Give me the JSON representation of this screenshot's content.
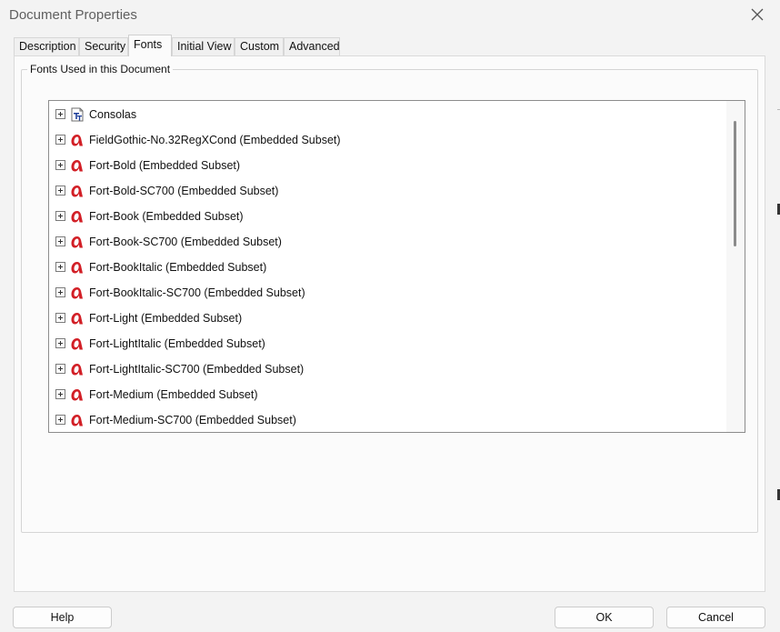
{
  "window": {
    "title": "Document Properties"
  },
  "tabs": [
    {
      "label": "Description",
      "active": false
    },
    {
      "label": "Security",
      "active": false
    },
    {
      "label": "Fonts",
      "active": true
    },
    {
      "label": "Initial View",
      "active": false
    },
    {
      "label": "Custom",
      "active": false
    },
    {
      "label": "Advanced",
      "active": false
    }
  ],
  "fonts_section": {
    "label": "Fonts Used in this Document",
    "items": [
      {
        "name": "Consolas",
        "icon": "truetype-font-icon"
      },
      {
        "name": "FieldGothic-No.32RegXCond (Embedded Subset)",
        "icon": "opentype-font-icon"
      },
      {
        "name": "Fort-Bold (Embedded Subset)",
        "icon": "opentype-font-icon"
      },
      {
        "name": "Fort-Bold-SC700 (Embedded Subset)",
        "icon": "opentype-font-icon"
      },
      {
        "name": "Fort-Book (Embedded Subset)",
        "icon": "opentype-font-icon"
      },
      {
        "name": "Fort-Book-SC700 (Embedded Subset)",
        "icon": "opentype-font-icon"
      },
      {
        "name": "Fort-BookItalic (Embedded Subset)",
        "icon": "opentype-font-icon"
      },
      {
        "name": "Fort-BookItalic-SC700 (Embedded Subset)",
        "icon": "opentype-font-icon"
      },
      {
        "name": "Fort-Light (Embedded Subset)",
        "icon": "opentype-font-icon"
      },
      {
        "name": "Fort-LightItalic (Embedded Subset)",
        "icon": "opentype-font-icon"
      },
      {
        "name": "Fort-LightItalic-SC700 (Embedded Subset)",
        "icon": "opentype-font-icon"
      },
      {
        "name": "Fort-Medium (Embedded Subset)",
        "icon": "opentype-font-icon"
      },
      {
        "name": "Fort-Medium-SC700 (Embedded Subset)",
        "icon": "opentype-font-icon"
      }
    ]
  },
  "buttons": {
    "help": "Help",
    "ok": "OK",
    "cancel": "Cancel"
  },
  "colors": {
    "opentype_icon": "#d21f26",
    "truetype_icon": "#1f3f9a",
    "dialog_bg": "#f3f3f3"
  }
}
